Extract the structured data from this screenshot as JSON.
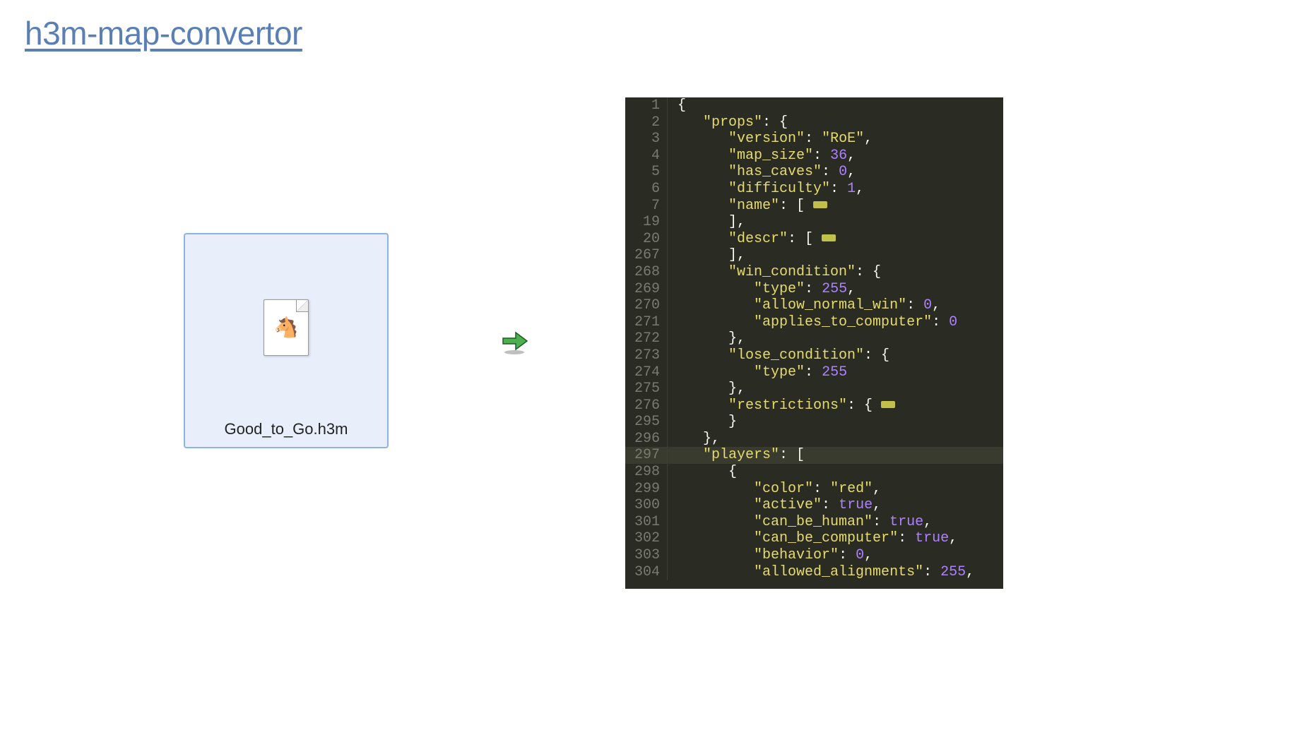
{
  "title": "h3m-map-convertor",
  "file": {
    "name": "Good_to_Go.h3m"
  },
  "arrow": {
    "name": "convert-right-arrow"
  },
  "code": {
    "lines": [
      {
        "n": "1",
        "tokens": [
          [
            "punct",
            "{"
          ]
        ]
      },
      {
        "n": "2",
        "tokens": [
          [
            "indent",
            "   "
          ],
          [
            "key",
            "\"props\""
          ],
          [
            "punct",
            ": {"
          ]
        ]
      },
      {
        "n": "3",
        "tokens": [
          [
            "indent",
            "      "
          ],
          [
            "key",
            "\"version\""
          ],
          [
            "punct",
            ": "
          ],
          [
            "str",
            "\"RoE\""
          ],
          [
            "punct",
            ","
          ]
        ]
      },
      {
        "n": "4",
        "tokens": [
          [
            "indent",
            "      "
          ],
          [
            "key",
            "\"map_size\""
          ],
          [
            "punct",
            ": "
          ],
          [
            "num",
            "36"
          ],
          [
            "punct",
            ","
          ]
        ]
      },
      {
        "n": "5",
        "tokens": [
          [
            "indent",
            "      "
          ],
          [
            "key",
            "\"has_caves\""
          ],
          [
            "punct",
            ": "
          ],
          [
            "num",
            "0"
          ],
          [
            "punct",
            ","
          ]
        ]
      },
      {
        "n": "6",
        "tokens": [
          [
            "indent",
            "      "
          ],
          [
            "key",
            "\"difficulty\""
          ],
          [
            "punct",
            ": "
          ],
          [
            "num",
            "1"
          ],
          [
            "punct",
            ","
          ]
        ]
      },
      {
        "n": "7",
        "tokens": [
          [
            "indent",
            "      "
          ],
          [
            "key",
            "\"name\""
          ],
          [
            "punct",
            ": [ "
          ],
          [
            "fold",
            ""
          ]
        ]
      },
      {
        "n": "19",
        "tokens": [
          [
            "indent",
            "      "
          ],
          [
            "punct",
            "],"
          ]
        ]
      },
      {
        "n": "20",
        "tokens": [
          [
            "indent",
            "      "
          ],
          [
            "key",
            "\"descr\""
          ],
          [
            "punct",
            ": [ "
          ],
          [
            "fold",
            ""
          ]
        ]
      },
      {
        "n": "267",
        "tokens": [
          [
            "indent",
            "      "
          ],
          [
            "punct",
            "],"
          ]
        ]
      },
      {
        "n": "268",
        "tokens": [
          [
            "indent",
            "      "
          ],
          [
            "key",
            "\"win_condition\""
          ],
          [
            "punct",
            ": {"
          ]
        ]
      },
      {
        "n": "269",
        "tokens": [
          [
            "indent",
            "         "
          ],
          [
            "key",
            "\"type\""
          ],
          [
            "punct",
            ": "
          ],
          [
            "num",
            "255"
          ],
          [
            "punct",
            ","
          ]
        ]
      },
      {
        "n": "270",
        "tokens": [
          [
            "indent",
            "         "
          ],
          [
            "key",
            "\"allow_normal_win\""
          ],
          [
            "punct",
            ": "
          ],
          [
            "num",
            "0"
          ],
          [
            "punct",
            ","
          ]
        ]
      },
      {
        "n": "271",
        "tokens": [
          [
            "indent",
            "         "
          ],
          [
            "key",
            "\"applies_to_computer\""
          ],
          [
            "punct",
            ": "
          ],
          [
            "num",
            "0"
          ]
        ]
      },
      {
        "n": "272",
        "tokens": [
          [
            "indent",
            "      "
          ],
          [
            "punct",
            "},"
          ]
        ]
      },
      {
        "n": "273",
        "tokens": [
          [
            "indent",
            "      "
          ],
          [
            "key",
            "\"lose_condition\""
          ],
          [
            "punct",
            ": {"
          ]
        ]
      },
      {
        "n": "274",
        "tokens": [
          [
            "indent",
            "         "
          ],
          [
            "key",
            "\"type\""
          ],
          [
            "punct",
            ": "
          ],
          [
            "num",
            "255"
          ]
        ]
      },
      {
        "n": "275",
        "tokens": [
          [
            "indent",
            "      "
          ],
          [
            "punct",
            "},"
          ]
        ]
      },
      {
        "n": "276",
        "tokens": [
          [
            "indent",
            "      "
          ],
          [
            "key",
            "\"restrictions\""
          ],
          [
            "punct",
            ": { "
          ],
          [
            "fold",
            ""
          ]
        ]
      },
      {
        "n": "295",
        "tokens": [
          [
            "indent",
            "      "
          ],
          [
            "punct",
            "}"
          ]
        ]
      },
      {
        "n": "296",
        "tokens": [
          [
            "indent",
            "   "
          ],
          [
            "punct",
            "},"
          ]
        ]
      },
      {
        "n": "297",
        "hl": true,
        "tokens": [
          [
            "indent",
            "   "
          ],
          [
            "key",
            "\"players\""
          ],
          [
            "punct",
            ": ["
          ]
        ]
      },
      {
        "n": "298",
        "tokens": [
          [
            "indent",
            "      "
          ],
          [
            "punct",
            "{"
          ]
        ]
      },
      {
        "n": "299",
        "tokens": [
          [
            "indent",
            "         "
          ],
          [
            "key",
            "\"color\""
          ],
          [
            "punct",
            ": "
          ],
          [
            "str",
            "\"red\""
          ],
          [
            "punct",
            ","
          ]
        ]
      },
      {
        "n": "300",
        "tokens": [
          [
            "indent",
            "         "
          ],
          [
            "key",
            "\"active\""
          ],
          [
            "punct",
            ": "
          ],
          [
            "bool",
            "true"
          ],
          [
            "punct",
            ","
          ]
        ]
      },
      {
        "n": "301",
        "tokens": [
          [
            "indent",
            "         "
          ],
          [
            "key",
            "\"can_be_human\""
          ],
          [
            "punct",
            ": "
          ],
          [
            "bool",
            "true"
          ],
          [
            "punct",
            ","
          ]
        ]
      },
      {
        "n": "302",
        "tokens": [
          [
            "indent",
            "         "
          ],
          [
            "key",
            "\"can_be_computer\""
          ],
          [
            "punct",
            ": "
          ],
          [
            "bool",
            "true"
          ],
          [
            "punct",
            ","
          ]
        ]
      },
      {
        "n": "303",
        "tokens": [
          [
            "indent",
            "         "
          ],
          [
            "key",
            "\"behavior\""
          ],
          [
            "punct",
            ": "
          ],
          [
            "num",
            "0"
          ],
          [
            "punct",
            ","
          ]
        ]
      },
      {
        "n": "304",
        "tokens": [
          [
            "indent",
            "         "
          ],
          [
            "key",
            "\"allowed_alignments\""
          ],
          [
            "punct",
            ": "
          ],
          [
            "num",
            "255"
          ],
          [
            "punct",
            ","
          ]
        ]
      }
    ]
  }
}
